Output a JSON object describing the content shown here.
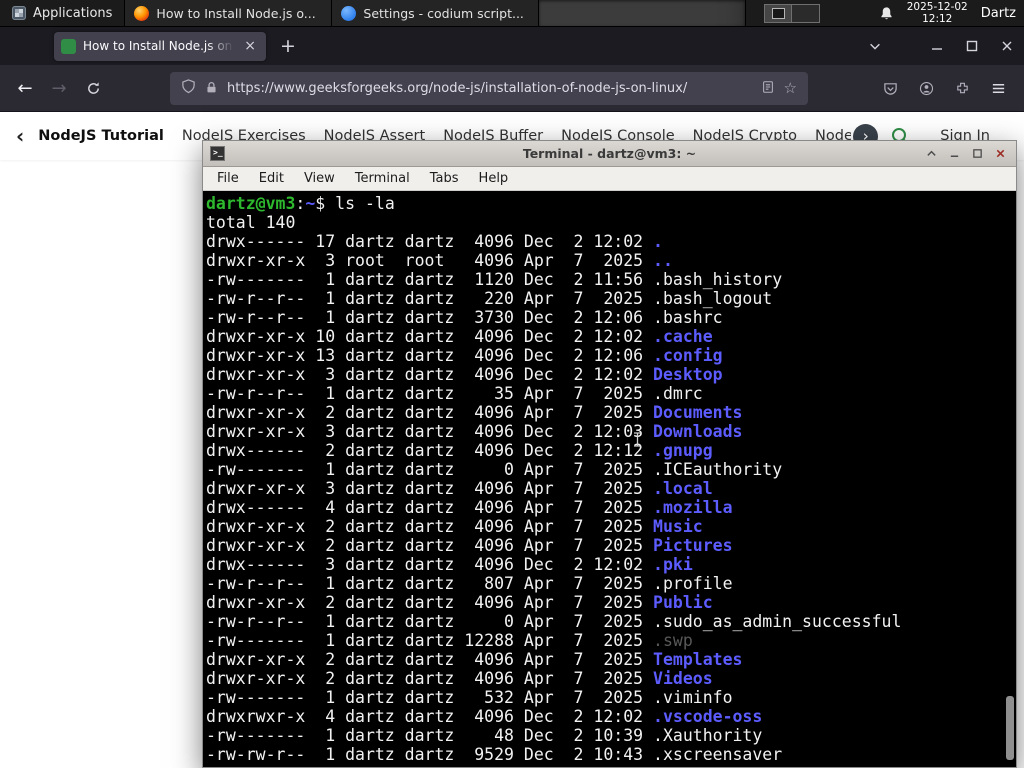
{
  "colors": {
    "gfg_green": "#2f8d46",
    "firefox_orange": "#ff9500",
    "codium_blue": "#2f80ed",
    "term_green": "#2eb82e",
    "term_blue": "#5c5cff",
    "term_fg": "#f2f2f2",
    "term_dim": "#585858"
  },
  "icons": {
    "back": "←",
    "forward": "→",
    "new_tab": "+",
    "tab_close": "×",
    "nav_scroll_left": "‹",
    "nav_scroll_right": "›",
    "star": "☆"
  },
  "panel": {
    "applications_label": "Applications",
    "windows": [
      {
        "title": "How to Install Node.js o...",
        "icon": "firefox",
        "active": false
      },
      {
        "title": "Settings - codium script...",
        "icon": "codium",
        "active": false
      },
      {
        "title": "Terminal - dartz@vm3: ~",
        "icon": "terminal",
        "active": true
      }
    ],
    "clock": {
      "date": "2025-12-02",
      "time": "12:12"
    },
    "user": "Dartz"
  },
  "browser": {
    "tab": {
      "title": "How to Install Node.js on"
    },
    "url": "https://www.geeksforgeeks.org/node-js/installation-of-node-js-on-linux/"
  },
  "site_nav": {
    "items": [
      {
        "label": "NodeJS Tutorial",
        "active": true
      },
      {
        "label": "NodeJS Exercises",
        "active": false
      },
      {
        "label": "NodeJS Assert",
        "active": false
      },
      {
        "label": "NodeJS Buffer",
        "active": false
      },
      {
        "label": "NodeJS Console",
        "active": false
      },
      {
        "label": "NodeJS Crypto",
        "active": false
      },
      {
        "label": "NodeJS DNS",
        "active": false
      },
      {
        "label": "Node",
        "active": false
      }
    ],
    "sign_in_label": "Sign In"
  },
  "terminal": {
    "title": "Terminal - dartz@vm3: ~",
    "menus": [
      "File",
      "Edit",
      "View",
      "Terminal",
      "Tabs",
      "Help"
    ],
    "screen": [
      [
        {
          "t": "dartz@vm3",
          "c": "green"
        },
        {
          "t": ":",
          "c": "fg"
        },
        {
          "t": "~",
          "c": "blue"
        },
        {
          "t": "$ ",
          "c": "fg"
        },
        {
          "t": "ls -la",
          "c": "fg"
        }
      ],
      [
        {
          "t": "total 140",
          "c": "fg"
        }
      ],
      [
        {
          "t": "drwx------ 17 dartz dartz  4096 Dec  2 12:02 ",
          "c": "fg"
        },
        {
          "t": ".",
          "c": "blue"
        }
      ],
      [
        {
          "t": "drwxr-xr-x  3 root  root   4096 Apr  7  2025 ",
          "c": "fg"
        },
        {
          "t": "..",
          "c": "blue"
        }
      ],
      [
        {
          "t": "-rw-------  1 dartz dartz  1120 Dec  2 11:56 ",
          "c": "fg"
        },
        {
          "t": ".bash_history",
          "c": "fg"
        }
      ],
      [
        {
          "t": "-rw-r--r--  1 dartz dartz   220 Apr  7  2025 ",
          "c": "fg"
        },
        {
          "t": ".bash_logout",
          "c": "fg"
        }
      ],
      [
        {
          "t": "-rw-r--r--  1 dartz dartz  3730 Dec  2 12:06 ",
          "c": "fg"
        },
        {
          "t": ".bashrc",
          "c": "fg"
        }
      ],
      [
        {
          "t": "drwxr-xr-x 10 dartz dartz  4096 Dec  2 12:02 ",
          "c": "fg"
        },
        {
          "t": ".cache",
          "c": "blue"
        }
      ],
      [
        {
          "t": "drwxr-xr-x 13 dartz dartz  4096 Dec  2 12:06 ",
          "c": "fg"
        },
        {
          "t": ".config",
          "c": "blue"
        }
      ],
      [
        {
          "t": "drwxr-xr-x  3 dartz dartz  4096 Dec  2 12:02 ",
          "c": "fg"
        },
        {
          "t": "Desktop",
          "c": "blue"
        }
      ],
      [
        {
          "t": "-rw-r--r--  1 dartz dartz    35 Apr  7  2025 ",
          "c": "fg"
        },
        {
          "t": ".dmrc",
          "c": "fg"
        }
      ],
      [
        {
          "t": "drwxr-xr-x  2 dartz dartz  4096 Apr  7  2025 ",
          "c": "fg"
        },
        {
          "t": "Documents",
          "c": "blue"
        }
      ],
      [
        {
          "t": "drwxr-xr-x  3 dartz dartz  4096 Dec  2 12:03 ",
          "c": "fg"
        },
        {
          "t": "Downloads",
          "c": "blue"
        }
      ],
      [
        {
          "t": "drwx------  2 dartz dartz  4096 Dec  2 12:12 ",
          "c": "fg"
        },
        {
          "t": ".gnupg",
          "c": "blue"
        }
      ],
      [
        {
          "t": "-rw-------  1 dartz dartz     0 Apr  7  2025 ",
          "c": "fg"
        },
        {
          "t": ".ICEauthority",
          "c": "fg"
        }
      ],
      [
        {
          "t": "drwxr-xr-x  3 dartz dartz  4096 Apr  7  2025 ",
          "c": "fg"
        },
        {
          "t": ".local",
          "c": "blue"
        }
      ],
      [
        {
          "t": "drwx------  4 dartz dartz  4096 Apr  7  2025 ",
          "c": "fg"
        },
        {
          "t": ".mozilla",
          "c": "blue"
        }
      ],
      [
        {
          "t": "drwxr-xr-x  2 dartz dartz  4096 Apr  7  2025 ",
          "c": "fg"
        },
        {
          "t": "Music",
          "c": "blue"
        }
      ],
      [
        {
          "t": "drwxr-xr-x  2 dartz dartz  4096 Apr  7  2025 ",
          "c": "fg"
        },
        {
          "t": "Pictures",
          "c": "blue"
        }
      ],
      [
        {
          "t": "drwx------  3 dartz dartz  4096 Dec  2 12:02 ",
          "c": "fg"
        },
        {
          "t": ".pki",
          "c": "blue"
        }
      ],
      [
        {
          "t": "-rw-r--r--  1 dartz dartz   807 Apr  7  2025 ",
          "c": "fg"
        },
        {
          "t": ".profile",
          "c": "fg"
        }
      ],
      [
        {
          "t": "drwxr-xr-x  2 dartz dartz  4096 Apr  7  2025 ",
          "c": "fg"
        },
        {
          "t": "Public",
          "c": "blue"
        }
      ],
      [
        {
          "t": "-rw-r--r--  1 dartz dartz     0 Apr  7  2025 ",
          "c": "fg"
        },
        {
          "t": ".sudo_as_admin_successful",
          "c": "fg"
        }
      ],
      [
        {
          "t": "-rw-------  1 dartz dartz 12288 Apr  7  2025 ",
          "c": "fg"
        },
        {
          "t": ".swp",
          "c": "dim"
        }
      ],
      [
        {
          "t": "drwxr-xr-x  2 dartz dartz  4096 Apr  7  2025 ",
          "c": "fg"
        },
        {
          "t": "Templates",
          "c": "blue"
        }
      ],
      [
        {
          "t": "drwxr-xr-x  2 dartz dartz  4096 Apr  7  2025 ",
          "c": "fg"
        },
        {
          "t": "Videos",
          "c": "blue"
        }
      ],
      [
        {
          "t": "-rw-------  1 dartz dartz   532 Apr  7  2025 ",
          "c": "fg"
        },
        {
          "t": ".viminfo",
          "c": "fg"
        }
      ],
      [
        {
          "t": "drwxrwxr-x  4 dartz dartz  4096 Dec  2 12:02 ",
          "c": "fg"
        },
        {
          "t": ".vscode-oss",
          "c": "blue"
        }
      ],
      [
        {
          "t": "-rw-------  1 dartz dartz    48 Dec  2 10:39 ",
          "c": "fg"
        },
        {
          "t": ".Xauthority",
          "c": "fg"
        }
      ],
      [
        {
          "t": "-rw-rw-r--  1 dartz dartz  9529 Dec  2 10:43 ",
          "c": "fg"
        },
        {
          "t": ".xscreensaver",
          "c": "fg"
        }
      ]
    ]
  }
}
